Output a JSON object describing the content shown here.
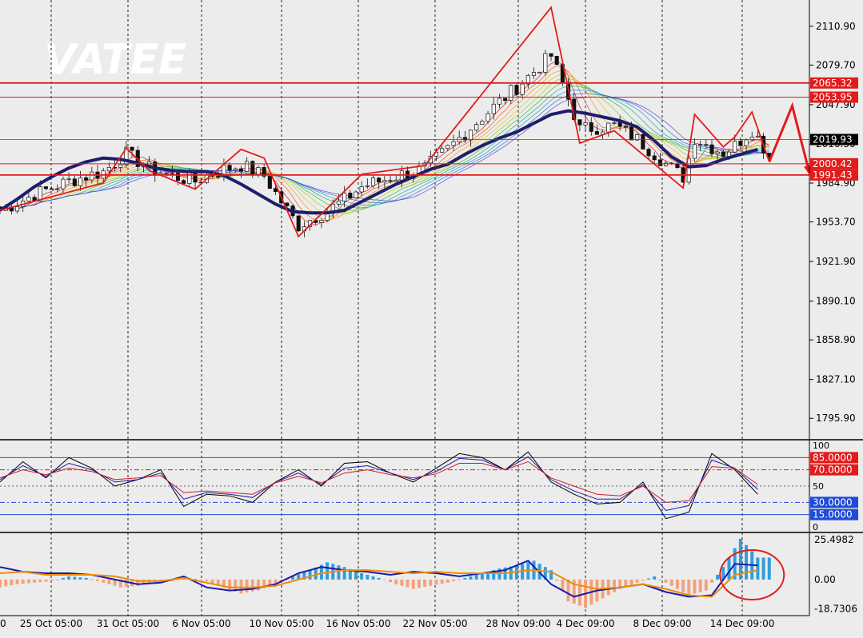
{
  "watermark": "VATEE",
  "colors": {
    "background": "#ececec",
    "bull": "#2e7d32",
    "bear": "#c62828",
    "pattern": "#e31b1b",
    "ma_thick": "#1e1e6e",
    "level_red": "#e31b1b",
    "level_blue": "#1f4bd8",
    "hist_pos": "#2f9ee0",
    "hist_neg": "#f2a27c",
    "signal": "#f08c00",
    "macd": "#1a1ab0"
  },
  "chart_data": [
    {
      "type": "line",
      "title": "",
      "xlabel": "",
      "ylabel": "",
      "ylim": [
        1780,
        2132
      ],
      "x_tick_labels": [
        "0",
        "25 Oct 05:00",
        "31 Oct 05:00",
        "6 Nov 05:00",
        "10 Nov 05:00",
        "16 Nov 05:00",
        "22 Nov 05:00",
        "28 Nov 09:00",
        "4 Dec 09:00",
        "8 Dec 09:00",
        "14 Dec 09:00"
      ],
      "y_tick_labels": [
        "2110.90",
        "2079.70",
        "2047.90",
        "2016.30",
        "1984.90",
        "1953.70",
        "1921.90",
        "1890.10",
        "1858.90",
        "1827.10",
        "1795.90"
      ],
      "horizontal_levels": [
        {
          "value": 2065.32,
          "label": "2065.32",
          "color": "red"
        },
        {
          "value": 2053.95,
          "label": "2053.95",
          "color": "red"
        },
        {
          "value": 2019.93,
          "label": "2019.93",
          "color": "blue-current"
        },
        {
          "value": 2000.42,
          "label": "2000.42",
          "color": "red"
        },
        {
          "value": 1991.43,
          "label": "1991.43",
          "color": "red"
        }
      ],
      "zigzag": [
        [
          0,
          1963
        ],
        [
          18,
          1985
        ],
        [
          22,
          2013
        ],
        [
          26,
          1995
        ],
        [
          34,
          1980
        ],
        [
          42,
          2012
        ],
        [
          46,
          2005
        ],
        [
          52,
          1942
        ],
        [
          63,
          1992
        ],
        [
          74,
          1999
        ],
        [
          96,
          2126
        ],
        [
          101,
          2017
        ],
        [
          107,
          2027
        ],
        [
          119,
          1981
        ],
        [
          121,
          2040
        ],
        [
          126,
          2014
        ],
        [
          128,
          2022
        ],
        [
          131,
          2042
        ],
        [
          134,
          2002
        ]
      ],
      "series": [
        {
          "name": "",
          "x": [
            0,
            3,
            6,
            9,
            12,
            15,
            18,
            21,
            24,
            27,
            30,
            33,
            36,
            39,
            42,
            45,
            48,
            51,
            54,
            57,
            60,
            63,
            66,
            69,
            72,
            75,
            78,
            81,
            84,
            87,
            90,
            93,
            96,
            99,
            102,
            105,
            108,
            111,
            114,
            117,
            120,
            123,
            126,
            129,
            132
          ],
          "values": [
            1963,
            1972,
            1982,
            1990,
            1997,
            2002,
            2005,
            2004,
            2001,
            1997,
            1995,
            1994,
            1994,
            1991,
            1984,
            1976,
            1968,
            1962,
            1961,
            1961,
            1963,
            1970,
            1977,
            1984,
            1990,
            1996,
            2000,
            2008,
            2015,
            2021,
            2026,
            2033,
            2040,
            2043,
            2041,
            2038,
            2035,
            2030,
            2019,
            2006,
            1998,
            1999,
            2004,
            2008,
            2012
          ]
        }
      ]
    },
    {
      "type": "line",
      "title": "",
      "ylim": [
        -5,
        105
      ],
      "y_tick_labels": [
        "100",
        "50",
        "0"
      ],
      "levels": [
        {
          "value": 85,
          "label": "85.0000",
          "color": "red"
        },
        {
          "value": 70,
          "label": "70.0000",
          "color": "red"
        },
        {
          "value": 30,
          "label": "30.0000",
          "color": "blue"
        },
        {
          "value": 15,
          "label": "15.0000",
          "color": "blue"
        }
      ],
      "series": [
        {
          "name": "",
          "color": "#000000",
          "x": [
            0,
            4,
            8,
            12,
            16,
            20,
            24,
            28,
            32,
            36,
            40,
            44,
            48,
            52,
            56,
            60,
            64,
            68,
            72,
            76,
            80,
            84,
            88,
            92,
            96,
            100,
            104,
            108,
            112,
            116,
            120,
            124,
            128,
            132
          ],
          "values": [
            55,
            80,
            60,
            85,
            72,
            50,
            58,
            70,
            25,
            40,
            38,
            30,
            55,
            70,
            50,
            78,
            80,
            66,
            55,
            72,
            90,
            85,
            70,
            92,
            55,
            40,
            28,
            30,
            55,
            10,
            18,
            90,
            70,
            40
          ]
        },
        {
          "name": "",
          "color": "#1a1ab0",
          "x": [
            0,
            4,
            8,
            12,
            16,
            20,
            24,
            28,
            32,
            36,
            40,
            44,
            48,
            52,
            56,
            60,
            64,
            68,
            72,
            76,
            80,
            84,
            88,
            92,
            96,
            100,
            104,
            108,
            112,
            116,
            120,
            124,
            128,
            132
          ],
          "values": [
            58,
            75,
            62,
            78,
            70,
            55,
            58,
            66,
            34,
            42,
            40,
            36,
            55,
            66,
            52,
            72,
            75,
            66,
            58,
            68,
            84,
            82,
            70,
            86,
            58,
            44,
            34,
            34,
            52,
            20,
            26,
            82,
            72,
            46
          ]
        },
        {
          "name": "",
          "color": "#d21f1f",
          "x": [
            0,
            4,
            8,
            12,
            16,
            20,
            24,
            28,
            32,
            36,
            40,
            44,
            48,
            52,
            56,
            60,
            64,
            68,
            72,
            76,
            80,
            84,
            88,
            92,
            96,
            100,
            104,
            108,
            112,
            116,
            120,
            124,
            128,
            132
          ],
          "values": [
            60,
            70,
            64,
            72,
            68,
            58,
            60,
            63,
            42,
            44,
            42,
            40,
            54,
            62,
            54,
            66,
            70,
            64,
            60,
            65,
            78,
            78,
            70,
            80,
            60,
            50,
            40,
            38,
            50,
            30,
            32,
            74,
            72,
            52
          ]
        }
      ]
    },
    {
      "type": "bar",
      "title": "",
      "ylim": [
        -22,
        29
      ],
      "y_tick_labels": [
        "25.4982",
        "0.00",
        "-18.7306"
      ],
      "series": [
        {
          "name": "",
          "x": [
            0,
            3,
            6,
            9,
            12,
            15,
            18,
            21,
            24,
            27,
            30,
            33,
            36,
            39,
            42,
            45,
            48,
            51,
            54,
            57,
            60,
            63,
            66,
            69,
            72,
            75,
            78,
            81,
            84,
            87,
            90,
            93,
            96,
            99,
            102,
            105,
            108,
            111,
            114,
            117,
            120,
            123,
            126,
            129,
            132
          ],
          "values": [
            -5,
            -3,
            -2,
            -1,
            2,
            1,
            -2,
            -5,
            -4,
            -2,
            -1,
            1,
            -1,
            -5,
            -9,
            -7,
            -3,
            2,
            6,
            11,
            8,
            4,
            1,
            -3,
            -6,
            -4,
            -2,
            1,
            4,
            7,
            9,
            12,
            6,
            -14,
            -18,
            -12,
            -6,
            -2,
            2,
            -4,
            -10,
            -7,
            8,
            26,
            14
          ]
        },
        {
          "name": "",
          "x": [
            0,
            4,
            8,
            12,
            16,
            20,
            24,
            28,
            32,
            36,
            40,
            44,
            48,
            52,
            56,
            60,
            64,
            68,
            72,
            76,
            80,
            84,
            88,
            92,
            96,
            100,
            104,
            108,
            112,
            116,
            120,
            124,
            128,
            132
          ],
          "values": [
            8,
            5,
            4,
            4,
            3,
            0,
            -3,
            -2,
            2,
            -5,
            -7,
            -6,
            -3,
            4,
            8,
            6,
            5,
            3,
            5,
            4,
            2,
            4,
            6,
            12,
            -3,
            -11,
            -7,
            -5,
            -3,
            -8,
            -11,
            -10,
            10,
            9
          ]
        },
        {
          "name": "",
          "x": [
            0,
            4,
            8,
            12,
            16,
            20,
            24,
            28,
            32,
            36,
            40,
            44,
            48,
            52,
            56,
            60,
            64,
            68,
            72,
            76,
            80,
            84,
            88,
            92,
            96,
            100,
            104,
            108,
            112,
            116,
            120,
            124,
            128,
            132
          ],
          "values": [
            4,
            5,
            3,
            3,
            3,
            2,
            -1,
            -1,
            1,
            -2,
            -5,
            -5,
            -4,
            0,
            4,
            6,
            6,
            5,
            4,
            5,
            4,
            4,
            4,
            6,
            5,
            -3,
            -6,
            -5,
            -3,
            -6,
            -10,
            -11,
            3,
            6
          ]
        }
      ],
      "circle_note": "marked-region"
    }
  ]
}
